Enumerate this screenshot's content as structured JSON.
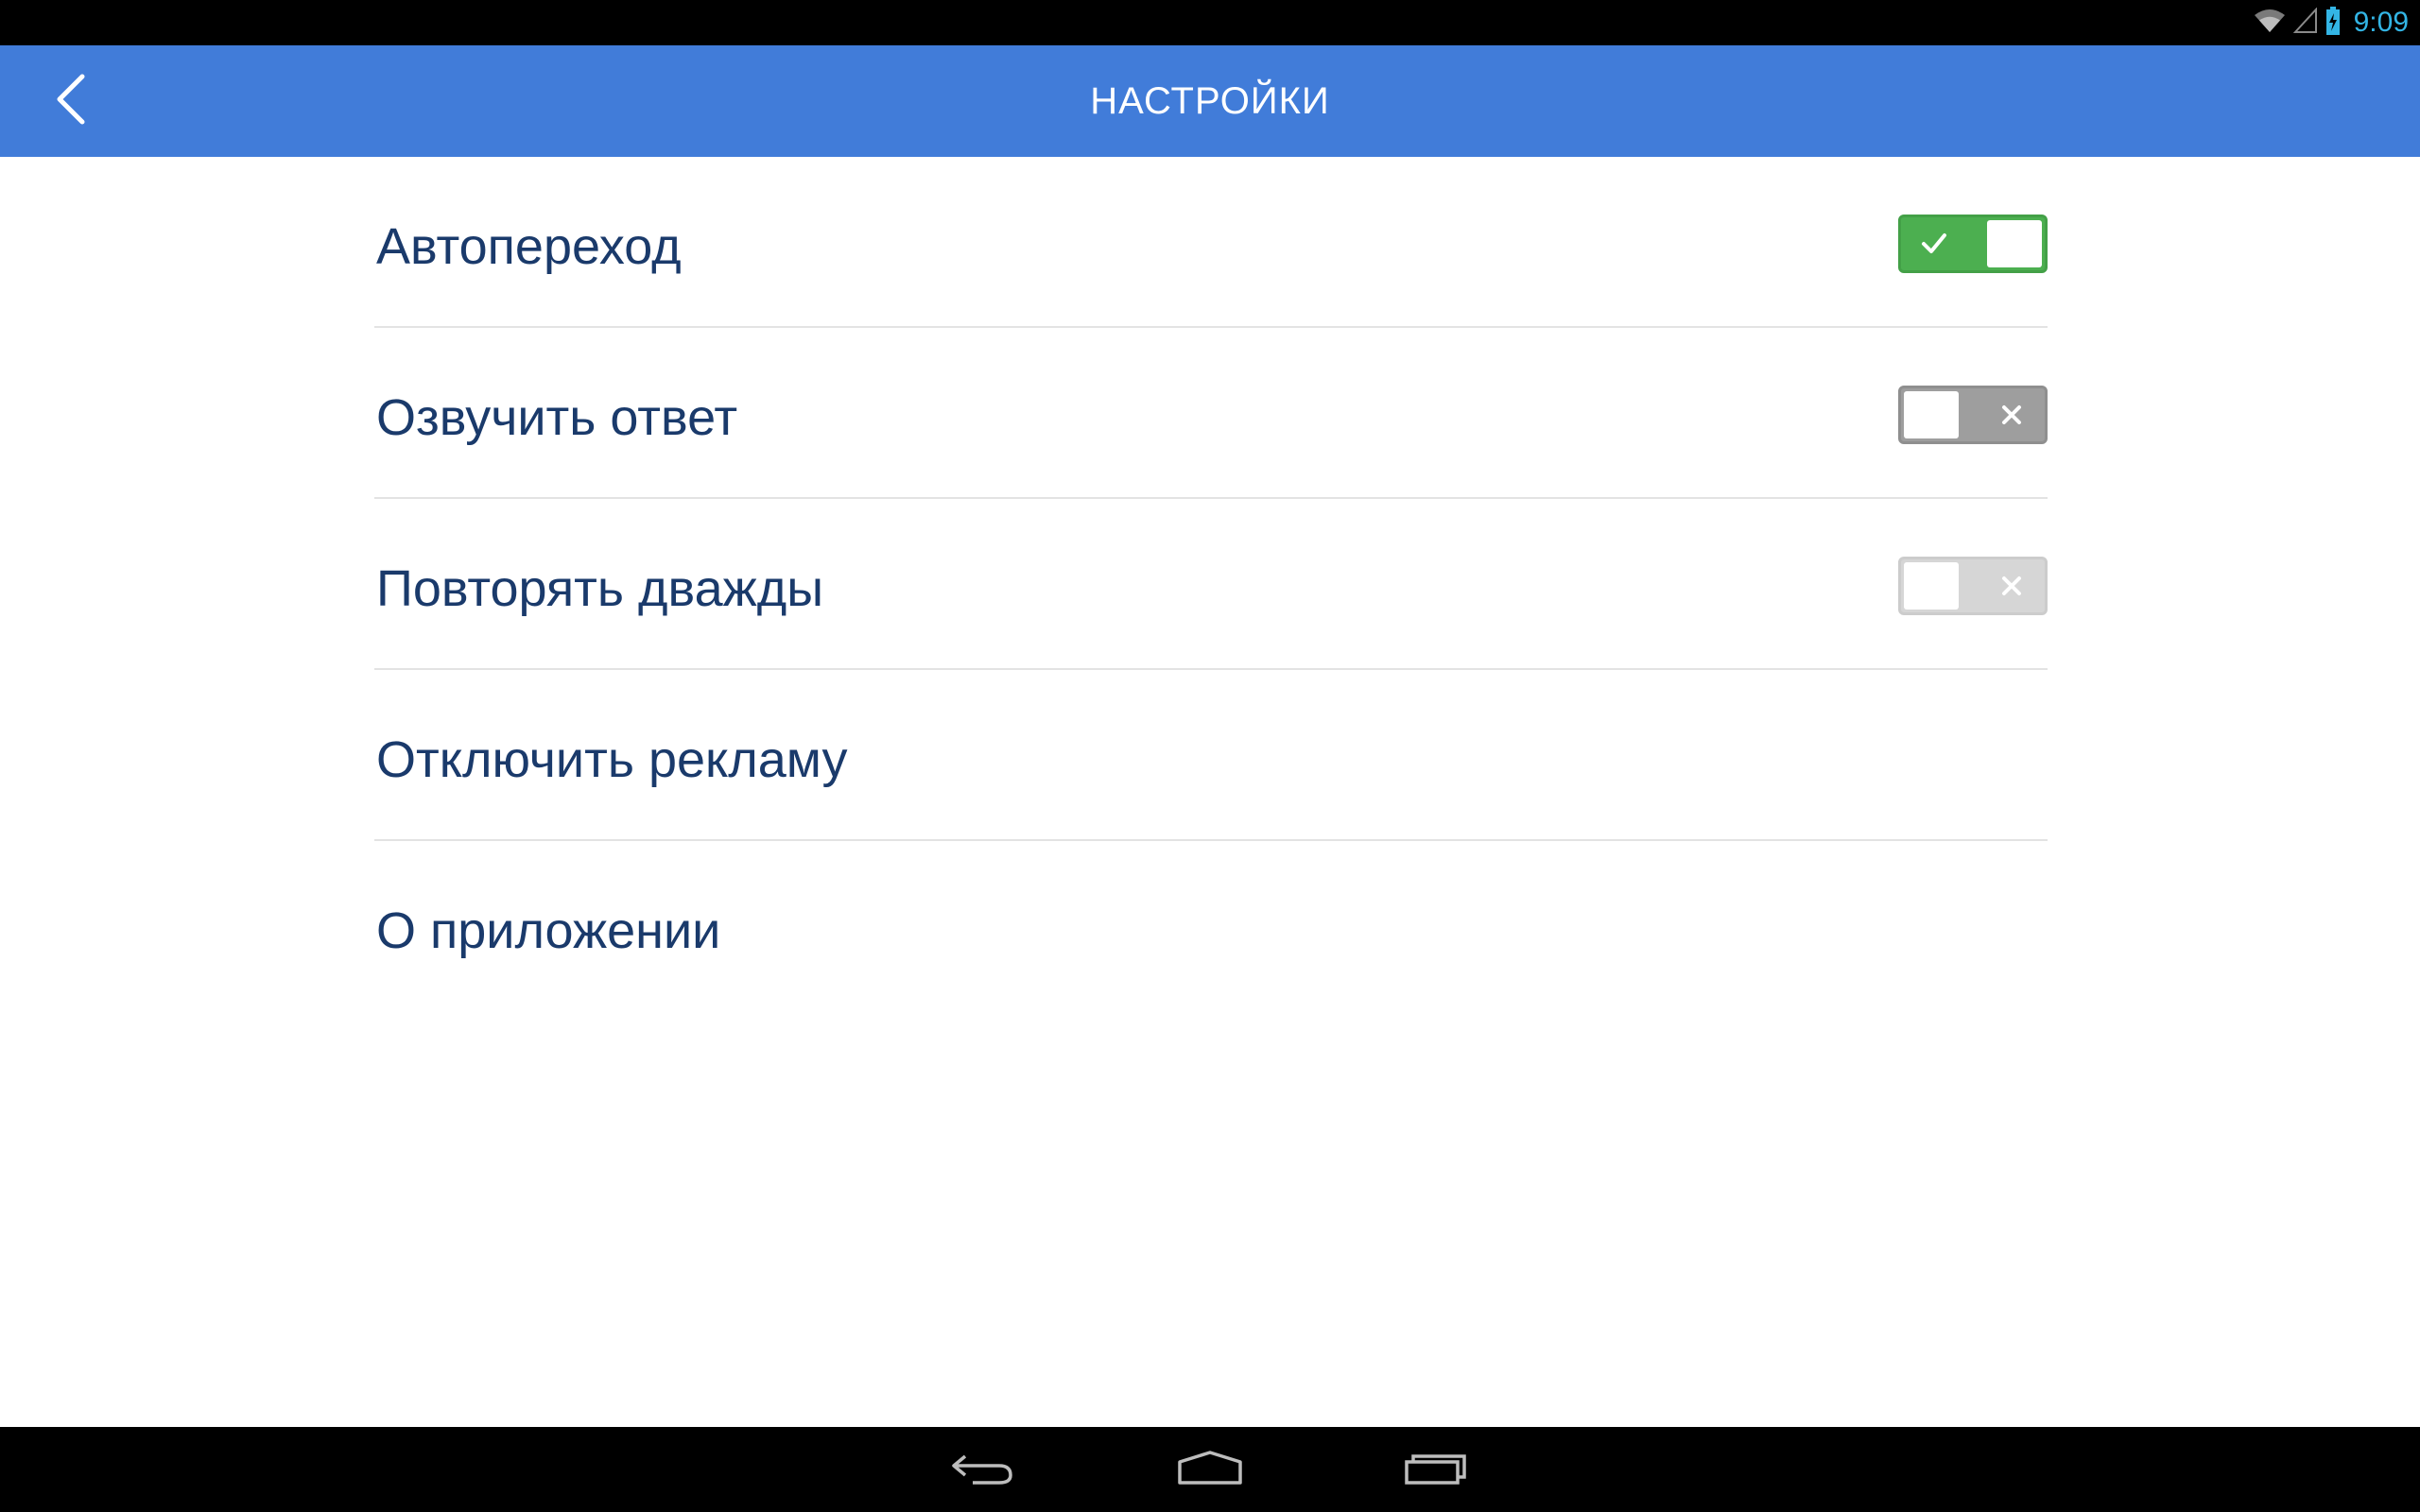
{
  "status_bar": {
    "time": "9:09",
    "icons": [
      "wifi-icon",
      "signal-icon",
      "battery-charging-icon"
    ],
    "time_color": "#33b5e5"
  },
  "app_bar": {
    "title": "НАСТРОЙКИ",
    "back_icon": "chevron-left-icon",
    "color": "#417cd9"
  },
  "settings": {
    "items": [
      {
        "label": "Автопереход",
        "toggle": "on"
      },
      {
        "label": "Озвучить ответ",
        "toggle": "off"
      },
      {
        "label": "Повторять дважды",
        "toggle": "off-disabled"
      },
      {
        "label": "Отключить рекламу"
      },
      {
        "label": "О приложении"
      }
    ],
    "toggle_on_color": "#4caf50",
    "toggle_off_color": "#9e9e9e",
    "toggle_disabled_color": "#d6d6d6"
  },
  "nav_bar": {
    "buttons": [
      "back-nav-icon",
      "home-nav-icon",
      "recents-nav-icon"
    ]
  }
}
